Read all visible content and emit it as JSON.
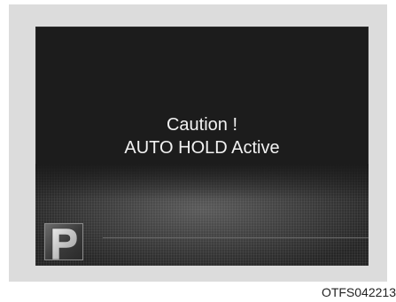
{
  "display": {
    "message_line1": "Caution !",
    "message_line2": "AUTO HOLD Active",
    "indicator_icon": "parking-p-icon",
    "indicator_letter": "P"
  },
  "caption": {
    "code": "OTFS042213"
  },
  "colors": {
    "screen_background": "#1c1c1c",
    "message_text": "#f2f2f2",
    "frame_background": "#dcdcdc"
  }
}
